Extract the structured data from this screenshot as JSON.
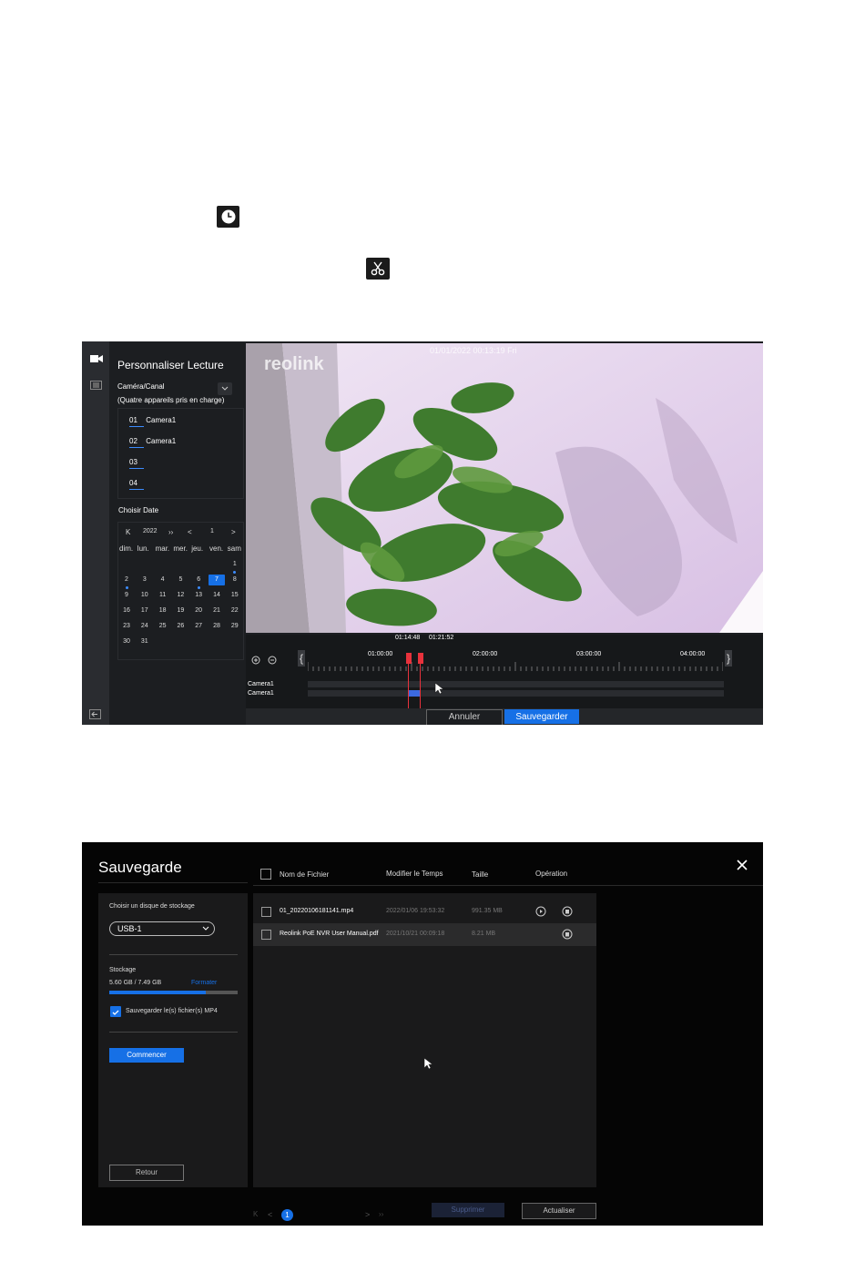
{
  "icons": {
    "clock": "clock-icon",
    "scissors": "scissors-icon"
  },
  "playback": {
    "title": "Personnaliser Lecture",
    "channel_label": "Caméra/Canal",
    "channel_note": "(Quatre appareils pris en charge)",
    "channels": [
      {
        "num": "01",
        "name": "Camera1"
      },
      {
        "num": "02",
        "name": "Camera1"
      },
      {
        "num": "03",
        "name": ""
      },
      {
        "num": "04",
        "name": ""
      }
    ],
    "date_label": "Choisir Date",
    "year": "2022",
    "month": "1",
    "weekdays": [
      "dim.",
      "lun.",
      "mar.",
      "mer.",
      "jeu.",
      "ven.",
      "sam"
    ],
    "days": [
      "1",
      "2",
      "3",
      "4",
      "5",
      "6",
      "7",
      "8",
      "9",
      "10",
      "11",
      "12",
      "13",
      "14",
      "15",
      "16",
      "17",
      "18",
      "19",
      "20",
      "21",
      "22",
      "23",
      "24",
      "25",
      "26",
      "27",
      "28",
      "29",
      "30",
      "31"
    ],
    "selected_day": "7",
    "overlay_logo": "reolink",
    "overlay_timestamp": "01/01/2022 00:13:19 Fri",
    "clip_start": "01:14:48",
    "clip_end": "01:21:52",
    "ticks": [
      "01:00:00",
      "02:00:00",
      "03:00:00",
      "04:00:00"
    ],
    "tracks": [
      "Camera1",
      "Camera1"
    ],
    "cancel_label": "Annuler",
    "save_label": "Sauvegarder",
    "accent": "#1670e6",
    "clip_color": "#e8323c"
  },
  "backup": {
    "title": "Sauvegarde",
    "close_icon": "close-icon",
    "columns": [
      "Nom de Fichier",
      "Modifier le Temps",
      "Taille",
      "Opération"
    ],
    "storage_label": "Choisir un disque de stockage",
    "disk": "USB-1",
    "storage_title": "Stockage",
    "storage_used": "5.60 GB / 7.49 GB",
    "storage_fraction": 0.75,
    "format_label": "Formater",
    "mp4_label": "Sauvegarder le(s) fichier(s) MP4",
    "start_label": "Commencer",
    "back_label": "Retour",
    "files": [
      {
        "name": "01_20220106181141.mp4",
        "time": "2022/01/06 19:53:32",
        "size": "991.35 MB"
      },
      {
        "name": "Reolink PoE NVR User Manual.pdf",
        "time": "2021/10/21 00:09:18",
        "size": "8.21 MB"
      }
    ],
    "page": "1",
    "delete_label": "Supprimer",
    "refresh_label": "Actualiser"
  }
}
